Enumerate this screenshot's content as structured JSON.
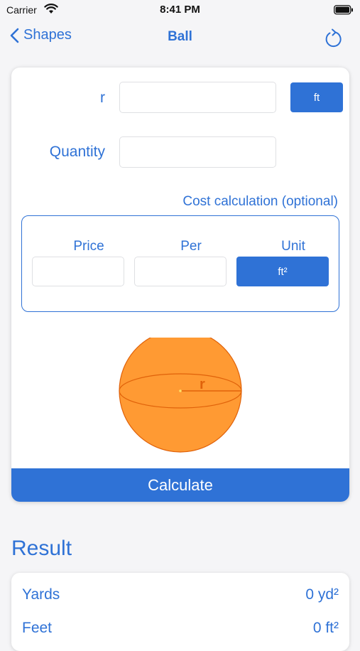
{
  "status_bar": {
    "carrier": "Carrier",
    "time": "8:41 PM",
    "wifi_icon": "wifi-icon",
    "battery_icon": "battery-icon"
  },
  "nav": {
    "back_label": "Shapes",
    "title": "Ball",
    "refresh_icon": "refresh-icon"
  },
  "form": {
    "r_label": "r",
    "r_value": "",
    "r_unit": "ft",
    "quantity_label": "Quantity",
    "quantity_value": ""
  },
  "cost": {
    "heading": "Cost calculation (optional)",
    "price_label": "Price",
    "price_value": "",
    "per_label": "Per",
    "per_value": "",
    "unit_label": "Unit",
    "unit_value": "ft²"
  },
  "diagram": {
    "radius_label": "r"
  },
  "calculate_label": "Calculate",
  "result": {
    "title": "Result",
    "rows": [
      {
        "label": "Yards",
        "value": "0 yd²"
      },
      {
        "label": "Feet",
        "value": "0 ft²"
      }
    ]
  },
  "colors": {
    "accent": "#2f72d6",
    "sphere_fill": "#ff9a33",
    "sphere_stroke": "#e0620a"
  }
}
